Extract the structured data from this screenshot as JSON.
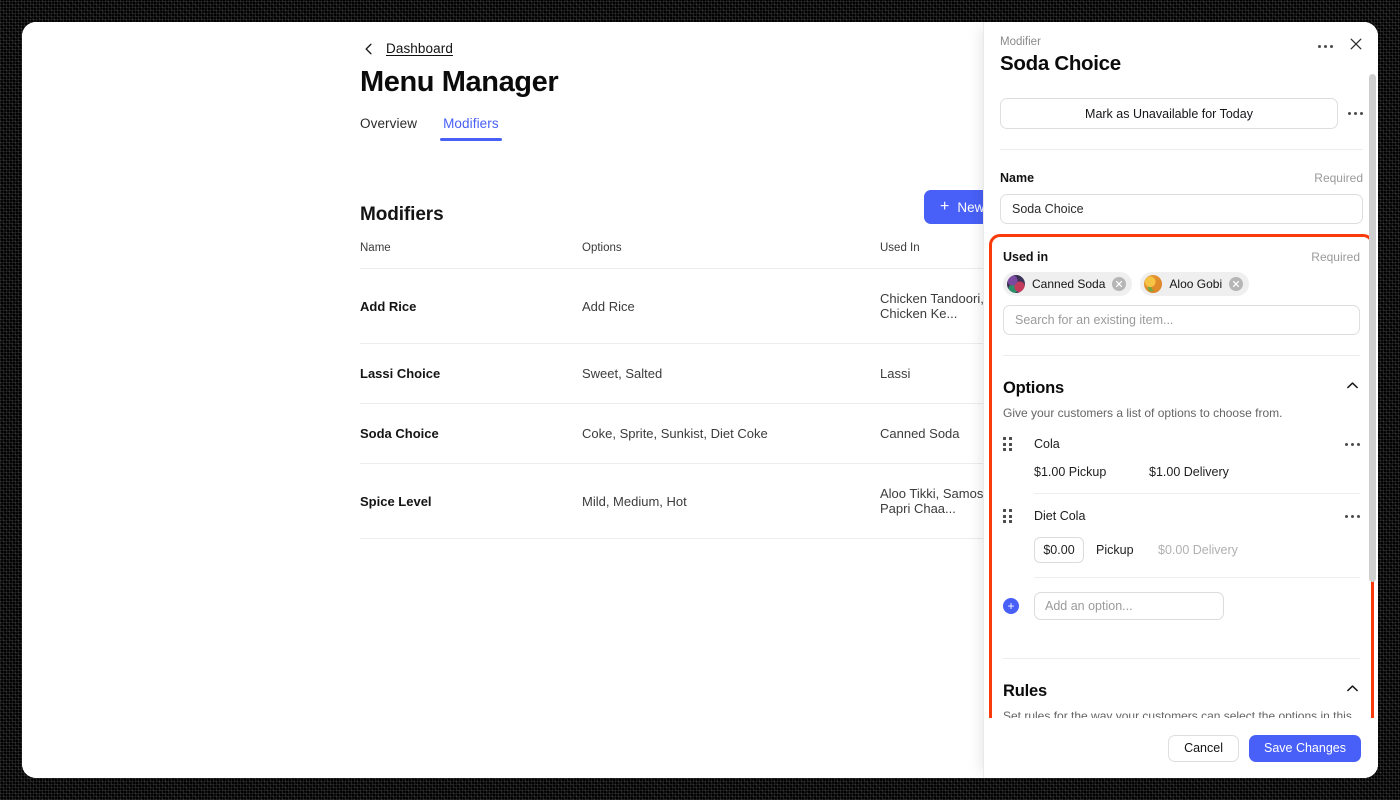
{
  "main": {
    "back_link": "Dashboard",
    "page_title": "Menu Manager",
    "tabs": [
      {
        "label": "Overview",
        "active": false
      },
      {
        "label": "Modifiers",
        "active": true
      }
    ],
    "section_title": "Modifiers",
    "new_button": "New",
    "table": {
      "columns": [
        "Name",
        "Options",
        "Used In"
      ],
      "rows": [
        {
          "name": "Add Rice",
          "options": "Add Rice",
          "used_in": "Chicken Tandoori, Chicken Ke..."
        },
        {
          "name": "Lassi Choice",
          "options": "Sweet, Salted",
          "used_in": "Lassi"
        },
        {
          "name": "Soda Choice",
          "options": "Coke, Sprite, Sunkist, Diet Coke",
          "used_in": "Canned Soda"
        },
        {
          "name": "Spice Level",
          "options": "Mild, Medium, Hot",
          "used_in": "Aloo Tikki, Samosa, Papri Chaa..."
        }
      ]
    }
  },
  "panel": {
    "eyebrow": "Modifier",
    "title": "Soda Choice",
    "availability_button": "Mark as Unavailable for Today",
    "name_field": {
      "label": "Name",
      "required_text": "Required",
      "value": "Soda Choice"
    },
    "used_in": {
      "label": "Used in",
      "required_text": "Required",
      "chips": [
        {
          "label": "Canned Soda",
          "thumb": "soda"
        },
        {
          "label": "Aloo Gobi",
          "thumb": "gobi"
        }
      ],
      "search_placeholder": "Search for an existing item..."
    },
    "options_section": {
      "title": "Options",
      "subtitle": "Give your customers a list of options to choose from.",
      "items": [
        {
          "name": "Cola",
          "pickup": "$1.00 Pickup",
          "delivery": "$1.00 Delivery",
          "editing": false
        },
        {
          "name": "Diet Cola",
          "pickup_value": "$0.00",
          "pickup_label": "Pickup",
          "delivery": "$0.00 Delivery",
          "editing": true
        }
      ],
      "add_placeholder": "Add an option..."
    },
    "rules_section": {
      "title": "Rules",
      "subtitle": "Set rules for the way your customers can select the options in this modifier."
    },
    "footer": {
      "cancel": "Cancel",
      "save": "Save Changes"
    }
  },
  "colors": {
    "accent": "#4860f7",
    "highlight": "#f93b0c",
    "text": "#0b0b0b",
    "muted": "#9a9a9a"
  }
}
